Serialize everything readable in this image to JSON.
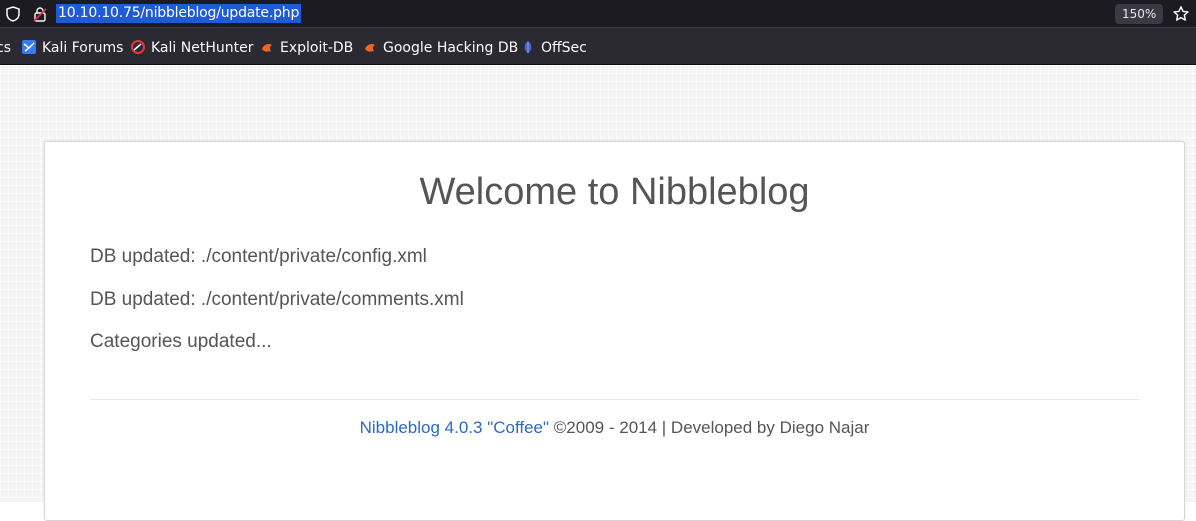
{
  "browser": {
    "url": "10.10.10.75/nibbleblog/update.php",
    "zoom": "150%",
    "bookmarks": [
      {
        "label": "cs",
        "icon": "bookmark-icon"
      },
      {
        "label": "Kali Forums",
        "icon": "kali-forums-icon"
      },
      {
        "label": "Kali NetHunter",
        "icon": "kali-nethunter-icon"
      },
      {
        "label": "Exploit-DB",
        "icon": "exploit-db-icon"
      },
      {
        "label": "Google Hacking DB",
        "icon": "ghdb-icon"
      },
      {
        "label": "OffSec",
        "icon": "offsec-icon"
      }
    ]
  },
  "page": {
    "title": "Welcome to Nibbleblog",
    "messages": [
      "DB updated: ./content/private/config.xml",
      "DB updated: ./content/private/comments.xml",
      "Categories updated..."
    ],
    "footer": {
      "link_text": "Nibbleblog 4.0.3 \"Coffee\"",
      "text": " ©2009 - 2014 | Developed by Diego Najar"
    }
  },
  "colors": {
    "url_highlight": "#1e5bd7",
    "link": "#2a6ac6",
    "text": "#555555"
  }
}
